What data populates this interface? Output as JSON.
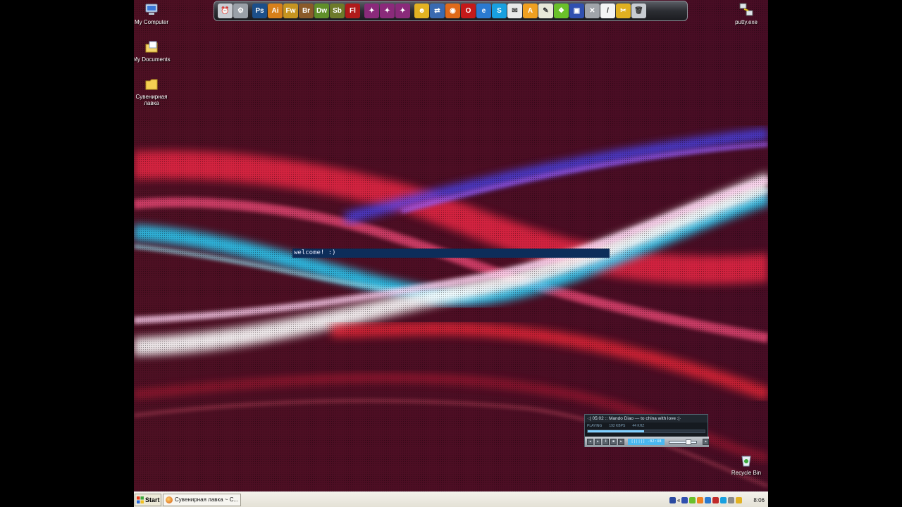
{
  "desktop": {
    "icons": [
      {
        "label": "My Computer",
        "icon": "my-computer-icon"
      },
      {
        "label": "My Documents",
        "icon": "my-documents-icon"
      },
      {
        "label": "Сувенирная лавка",
        "icon": "folder-icon"
      },
      {
        "label": "putty.exe",
        "icon": "putty-icon"
      },
      {
        "label": "Recycle Bin",
        "icon": "recycle-bin-icon"
      }
    ]
  },
  "dock": {
    "items": [
      {
        "name": "alarm-clock-icon",
        "text": "⏰",
        "color": "#c9ccd2"
      },
      {
        "name": "gear-icon",
        "text": "⚙",
        "color": "#9aa0a8"
      },
      {
        "name": "photoshop-icon",
        "text": "Ps",
        "color": "#1c4f8a"
      },
      {
        "name": "illustrator-icon",
        "text": "Ai",
        "color": "#d8801a"
      },
      {
        "name": "fireworks-icon",
        "text": "Fw",
        "color": "#c59420"
      },
      {
        "name": "bridge-icon",
        "text": "Br",
        "color": "#8a5a2a"
      },
      {
        "name": "dreamweaver-icon",
        "text": "Dw",
        "color": "#5f8f2a"
      },
      {
        "name": "soundbooth-icon",
        "text": "Sb",
        "color": "#6d7a2a"
      },
      {
        "name": "flash-icon",
        "text": "Fl",
        "color": "#b01a1a"
      },
      {
        "name": "cube-app-1-icon",
        "text": "✦",
        "color": "#8a2a7a"
      },
      {
        "name": "cube-app-2-icon",
        "text": "✦",
        "color": "#8a2a7a"
      },
      {
        "name": "cube-app-3-icon",
        "text": "✦",
        "color": "#8a2a7a"
      },
      {
        "name": "messenger-icon",
        "text": "☻",
        "color": "#e2b222"
      },
      {
        "name": "network-icon",
        "text": "⇄",
        "color": "#3a6ab0"
      },
      {
        "name": "firefox-icon",
        "text": "◉",
        "color": "#e06a1a"
      },
      {
        "name": "opera-icon",
        "text": "O",
        "color": "#c41a1a"
      },
      {
        "name": "internet-explorer-icon",
        "text": "e",
        "color": "#2a7ad0"
      },
      {
        "name": "skype-icon",
        "text": "S",
        "color": "#18a0e0"
      },
      {
        "name": "mail-icon",
        "text": "✉",
        "color": "#e8e8e8"
      },
      {
        "name": "aimp-icon",
        "text": "A",
        "color": "#f0a020"
      },
      {
        "name": "notepad-icon",
        "text": "✎",
        "color": "#e8e8d8"
      },
      {
        "name": "evernote-icon",
        "text": "❖",
        "color": "#6ac02a"
      },
      {
        "name": "save-disk-icon",
        "text": "▣",
        "color": "#3050b0"
      },
      {
        "name": "tools-icon",
        "text": "✕",
        "color": "#a0a4aa"
      },
      {
        "name": "terminal-icon",
        "text": "/",
        "color": "#f4f4f4"
      },
      {
        "name": "yellow-tools-icon",
        "text": "✂",
        "color": "#e0b020"
      },
      {
        "name": "trash-dock-icon",
        "text": "🗑",
        "color": "#c8ccd2"
      }
    ]
  },
  "welcome": {
    "text": "welcome! :)"
  },
  "player": {
    "title": "·:| 05:02 :: Mando Diao — to china with love :|·",
    "status": "PLAYING",
    "bitrate": "192 KBPS",
    "samplerate": "44 KHZ",
    "progress": 0.48,
    "time": "[||||]  -02:48",
    "volume": 0.75,
    "buttons": [
      "prev",
      "play",
      "pause",
      "stop",
      "next",
      "eject"
    ]
  },
  "taskbar": {
    "start_label": "Start",
    "task_label": "Сувенирная лавка ~ С...",
    "clock": "8:06"
  },
  "colors": {
    "desktop_bg": "#4a0f26",
    "welcome_bar": "#0d2d5a",
    "taskbar": "#ece9d8",
    "player_accent": "#49b8f0"
  }
}
